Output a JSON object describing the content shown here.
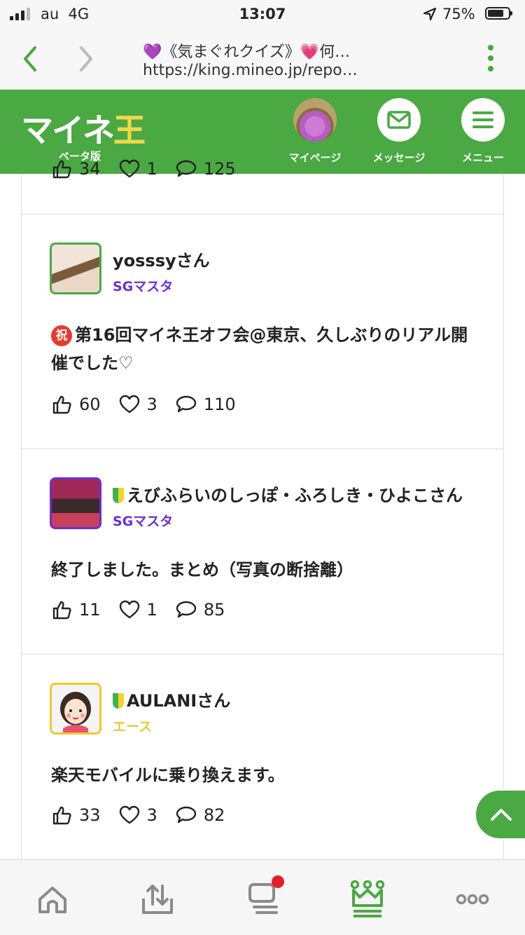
{
  "status_bar": {
    "carrier": "au",
    "network": "4G",
    "time": "13:07",
    "battery_percent": "75%"
  },
  "browser": {
    "page_title": "💜《気まぐれクイズ》💗何…",
    "url": "https://king.mineo.jp/repo…"
  },
  "site_header": {
    "logo_text": [
      "マ",
      "イ",
      "ネ",
      "王"
    ],
    "logo_subtitle": "ベータ版",
    "nav": {
      "mypage": "マイページ",
      "message": "メッセージ",
      "menu": "メニュー"
    }
  },
  "partial_post": {
    "likes": "34",
    "hearts": "1",
    "comments": "125"
  },
  "posts": [
    {
      "author": "yosssyさん",
      "rank": "SGマスタ",
      "badge": "祝",
      "title": "第16回マイネ王オフ会@東京、久しぶりのリアル開催でした♡",
      "likes": "60",
      "hearts": "3",
      "comments": "110"
    },
    {
      "author": "えびふらいのしっぽ・ふろしき・ひよこさん",
      "rank": "SGマスタ",
      "title": "終了しました。まとめ（写真の断捨離）",
      "likes": "11",
      "hearts": "1",
      "comments": "85"
    },
    {
      "author": "AULANIさん",
      "rank": "エース",
      "title": "楽天モバイルに乗り換えます。",
      "likes": "33",
      "hearts": "3",
      "comments": "82"
    }
  ],
  "colors": {
    "brand_green": "#4aa942",
    "rank_sg": "#6b2fd6",
    "rank_ace": "#f0c92f",
    "notification": "#e61e2b"
  },
  "icons": [
    "back-icon",
    "forward-icon",
    "more-vert-icon",
    "mail-icon",
    "hamburger-icon",
    "thumbs-up-icon",
    "heart-icon",
    "comment-icon",
    "chevron-up-icon",
    "home-icon",
    "upload-icon",
    "chat-icon",
    "crown-icon",
    "more-horiz-icon"
  ]
}
